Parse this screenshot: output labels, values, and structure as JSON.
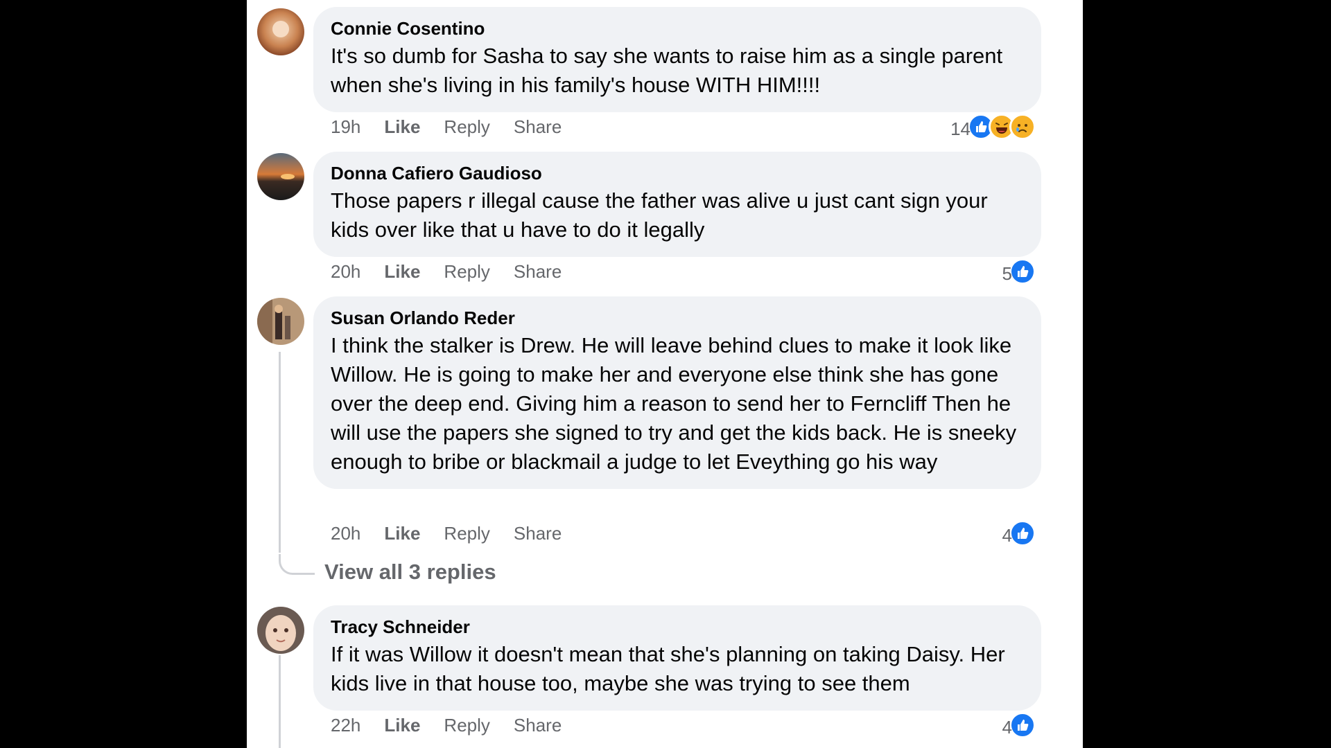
{
  "comments": [
    {
      "author": "Connie Cosentino",
      "text": "It's so dumb for Sasha to say she wants to raise him as a single parent when she's living in his family's house WITH HIM!!!!",
      "time": "19h",
      "like": "Like",
      "reply": "Reply",
      "share": "Share",
      "reaction_count": "14",
      "reactions": [
        "like",
        "haha",
        "sad"
      ]
    },
    {
      "author": "Donna Cafiero Gaudioso",
      "text": "Those papers r illegal cause the father was alive u just cant sign your kids over like that u have to do it legally",
      "time": "20h",
      "like": "Like",
      "reply": "Reply",
      "share": "Share",
      "reaction_count": "5",
      "reactions": [
        "like"
      ]
    },
    {
      "author": "Susan Orlando Reder",
      "text": "I think the stalker is Drew. He will leave behind clues to make it look like Willow. He is going to make her and everyone else think she has gone over the deep end. Giving him a reason to send her to Ferncliff Then he will use the papers she signed to try and get the kids back. He is sneeky enough to bribe or blackmail a judge to let Eveything go his way",
      "time": "20h",
      "like": "Like",
      "reply": "Reply",
      "share": "Share",
      "reaction_count": "4",
      "reactions": [
        "like"
      ],
      "view_replies": "View all 3 replies"
    },
    {
      "author": "Tracy Schneider",
      "text": "If it was Willow it doesn't mean that she's planning on taking Daisy. Her kids live in that house too, maybe she was trying to see them",
      "time": "22h",
      "like": "Like",
      "reply": "Reply",
      "share": "Share",
      "reaction_count": "4",
      "reactions": [
        "like"
      ]
    }
  ],
  "colors": {
    "bubble": "#f0f2f5",
    "meta_text": "#65676b",
    "like_blue": "#1877f2",
    "background": "#000000"
  }
}
